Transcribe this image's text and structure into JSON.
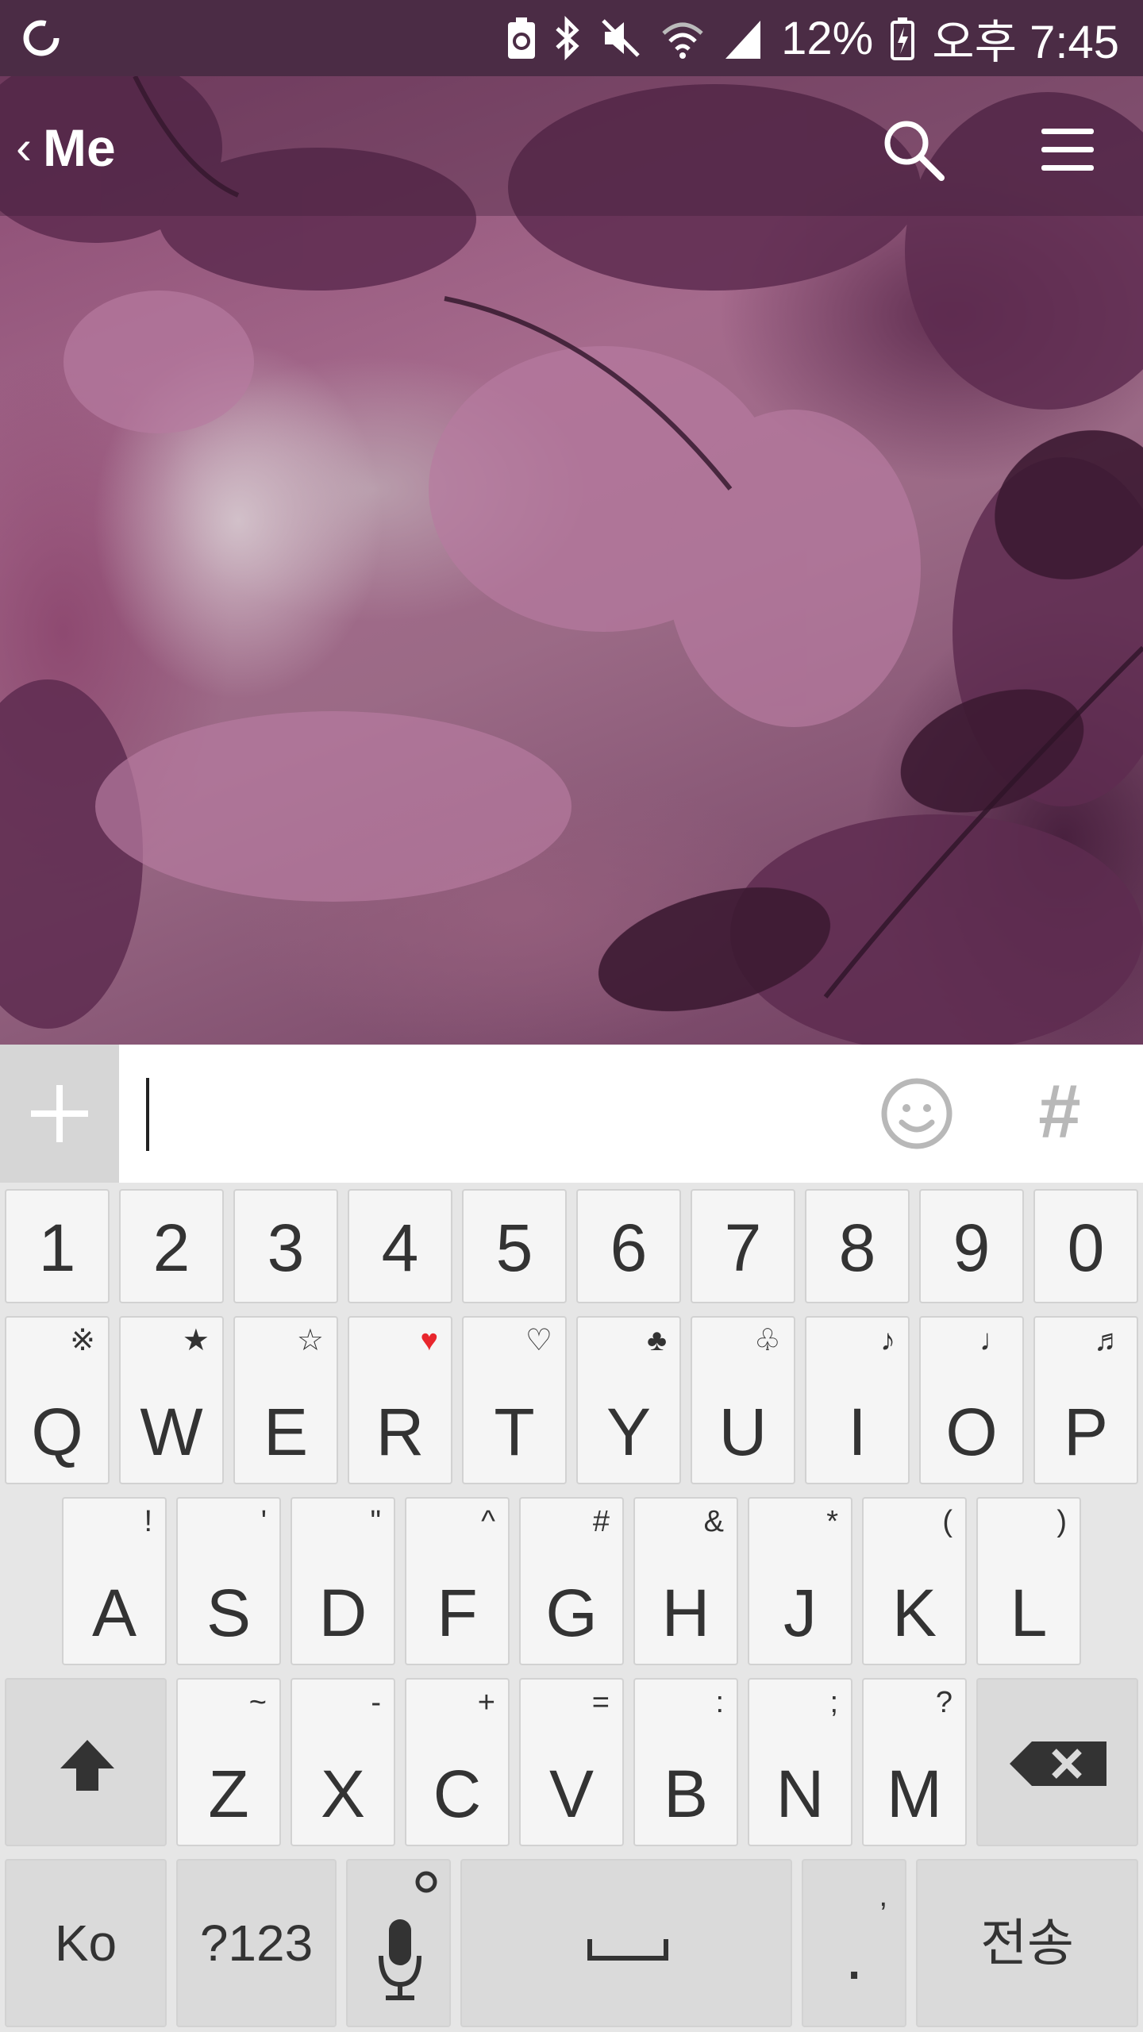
{
  "status_bar": {
    "battery_percent": "12%",
    "time": "오후 7:45",
    "icons": [
      "sync-icon",
      "battery-saver-icon",
      "bluetooth-icon",
      "vibrate-icon",
      "wifi-icon",
      "signal-icon",
      "battery-charging-icon"
    ]
  },
  "chat_header": {
    "back_chevron": "‹",
    "title": "Me",
    "icons": [
      "search-icon",
      "menu-icon"
    ]
  },
  "input_bar": {
    "placeholder": "",
    "value": "",
    "plus_icon": "plus-icon",
    "emoji_icon": "emoji-icon",
    "hashtag_label": "#"
  },
  "keyboard": {
    "number_row": [
      "1",
      "2",
      "3",
      "4",
      "5",
      "6",
      "7",
      "8",
      "9",
      "0"
    ],
    "row1": [
      {
        "main": "Q",
        "sub": "※"
      },
      {
        "main": "W",
        "sub": "★"
      },
      {
        "main": "E",
        "sub": "☆"
      },
      {
        "main": "R",
        "sub": "♥"
      },
      {
        "main": "T",
        "sub": "♡"
      },
      {
        "main": "Y",
        "sub": "♣"
      },
      {
        "main": "U",
        "sub": "♧"
      },
      {
        "main": "I",
        "sub": "♪"
      },
      {
        "main": "O",
        "sub": "♩"
      },
      {
        "main": "P",
        "sub": "♬"
      }
    ],
    "row2": [
      {
        "main": "A",
        "sub": "!"
      },
      {
        "main": "S",
        "sub": "'"
      },
      {
        "main": "D",
        "sub": "\""
      },
      {
        "main": "F",
        "sub": "^"
      },
      {
        "main": "G",
        "sub": "#"
      },
      {
        "main": "H",
        "sub": "&"
      },
      {
        "main": "J",
        "sub": "*"
      },
      {
        "main": "K",
        "sub": "("
      },
      {
        "main": "L",
        "sub": ")"
      }
    ],
    "row3": [
      {
        "main": "Z",
        "sub": "~"
      },
      {
        "main": "X",
        "sub": "-"
      },
      {
        "main": "C",
        "sub": "+"
      },
      {
        "main": "V",
        "sub": "="
      },
      {
        "main": "B",
        "sub": ":"
      },
      {
        "main": "N",
        "sub": ";"
      },
      {
        "main": "M",
        "sub": "?"
      }
    ],
    "shift_icon": "shift-icon",
    "backspace_icon": "backspace-icon",
    "bottom_row": {
      "lang": "Ko",
      "symbols": "?123",
      "mic_icon": "mic-icon",
      "space_symbol": "␣",
      "period": ".",
      "period_sub": ",",
      "send": "전송"
    }
  },
  "colors": {
    "status_bar": "#4b2c45",
    "accent_red": "#e8262d",
    "key_bg": "#f5f5f5",
    "key_dark_bg": "#dadada"
  }
}
